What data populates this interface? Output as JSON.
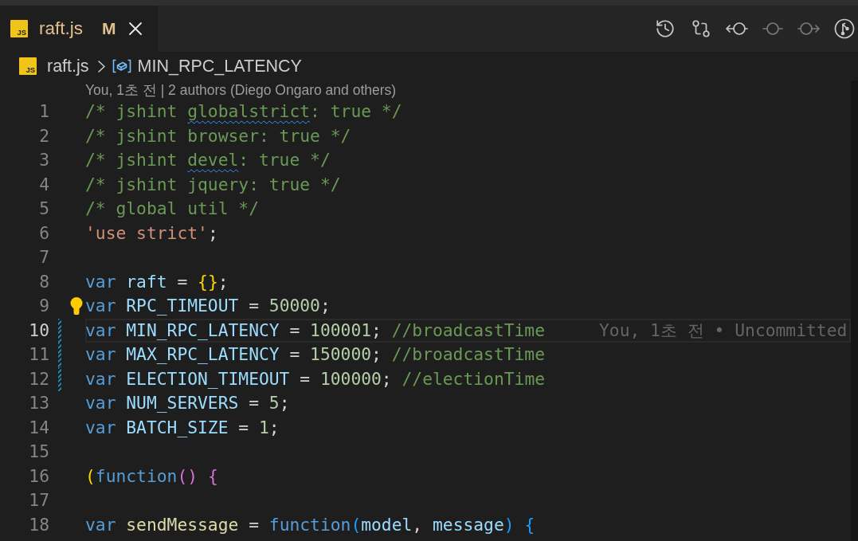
{
  "tabs": [
    {
      "icon_label": "JS",
      "label": "raft.js",
      "status": "M",
      "selected": true,
      "modified": true
    }
  ],
  "toolbar": [
    {
      "kind": "history",
      "disabled": false
    },
    {
      "kind": "compare",
      "disabled": false
    },
    {
      "kind": "previous",
      "disabled": false
    },
    {
      "kind": "commit",
      "disabled": true
    },
    {
      "kind": "next",
      "disabled": true
    },
    {
      "kind": "inspect",
      "disabled": false
    }
  ],
  "breadcrumbs": [
    {
      "kind": "file",
      "icon_label": "JS",
      "label": "raft.js"
    },
    {
      "kind": "variable",
      "label": "MIN_RPC_LATENCY"
    }
  ],
  "code_lens": "You, 1초 전 | 2 authors (Diego Ongaro and others)",
  "lines": [
    {
      "number": "1",
      "current": false,
      "changed": false,
      "lightbulb": false,
      "tokens": [
        {
          "kind": "comment",
          "text": "/* jshint ",
          "squiggle": false
        },
        {
          "kind": "comment",
          "text": "globalstrict",
          "squiggle": true
        },
        {
          "kind": "comment",
          "text": ": true */",
          "squiggle": false
        }
      ]
    },
    {
      "number": "2",
      "current": false,
      "changed": false,
      "lightbulb": false,
      "tokens": [
        {
          "kind": "comment",
          "text": "/* jshint browser: true */"
        }
      ]
    },
    {
      "number": "3",
      "current": false,
      "changed": false,
      "lightbulb": false,
      "tokens": [
        {
          "kind": "comment",
          "text": "/* jshint ",
          "squiggle": false
        },
        {
          "kind": "comment",
          "text": "devel",
          "squiggle": true
        },
        {
          "kind": "comment",
          "text": ": true */",
          "squiggle": false
        }
      ]
    },
    {
      "number": "4",
      "current": false,
      "changed": false,
      "lightbulb": false,
      "tokens": [
        {
          "kind": "comment",
          "text": "/* jshint jquery: true */"
        }
      ]
    },
    {
      "number": "5",
      "current": false,
      "changed": false,
      "lightbulb": false,
      "tokens": [
        {
          "kind": "comment",
          "text": "/* global util */"
        }
      ]
    },
    {
      "number": "6",
      "current": false,
      "changed": false,
      "lightbulb": false,
      "tokens": [
        {
          "kind": "string",
          "text": "'use strict'"
        },
        {
          "kind": "punct",
          "text": ";"
        }
      ]
    },
    {
      "number": "7",
      "current": false,
      "changed": false,
      "lightbulb": false
    },
    {
      "number": "8",
      "current": false,
      "changed": false,
      "lightbulb": false,
      "tokens": [
        {
          "kind": "keyword",
          "text": "var "
        },
        {
          "kind": "variable",
          "text": "raft"
        },
        {
          "kind": "operator",
          "text": " = "
        },
        {
          "kind": "bracket",
          "text": "{}",
          "color": "#ffd700"
        },
        {
          "kind": "punct",
          "text": ";"
        }
      ]
    },
    {
      "number": "9",
      "current": false,
      "changed": false,
      "lightbulb": true,
      "tokens": [
        {
          "kind": "keyword",
          "text": "var "
        },
        {
          "kind": "variable",
          "text": "RPC_TIMEOUT"
        },
        {
          "kind": "operator",
          "text": " = "
        },
        {
          "kind": "number",
          "text": "50000"
        },
        {
          "kind": "punct",
          "text": ";"
        }
      ]
    },
    {
      "number": "10",
      "current": true,
      "changed": true,
      "lightbulb": false,
      "tokens": [
        {
          "kind": "keyword",
          "text": "var "
        },
        {
          "kind": "variable",
          "text": "MIN_RPC_LATENCY"
        },
        {
          "kind": "operator",
          "text": " = "
        },
        {
          "kind": "number",
          "text": "100001"
        },
        {
          "kind": "punct",
          "text": "; "
        },
        {
          "kind": "comment",
          "text": "//broadcastTime"
        }
      ],
      "blame": "You, 1초 전 • Uncommitted"
    },
    {
      "number": "11",
      "current": false,
      "changed": true,
      "lightbulb": false,
      "tokens": [
        {
          "kind": "keyword",
          "text": "var "
        },
        {
          "kind": "variable",
          "text": "MAX_RPC_LATENCY"
        },
        {
          "kind": "operator",
          "text": " = "
        },
        {
          "kind": "number",
          "text": "150000"
        },
        {
          "kind": "punct",
          "text": "; "
        },
        {
          "kind": "comment",
          "text": "//broadcastTime"
        }
      ]
    },
    {
      "number": "12",
      "current": false,
      "changed": true,
      "lightbulb": false,
      "tokens": [
        {
          "kind": "keyword",
          "text": "var "
        },
        {
          "kind": "variable",
          "text": "ELECTION_TIMEOUT"
        },
        {
          "kind": "operator",
          "text": " = "
        },
        {
          "kind": "number",
          "text": "100000"
        },
        {
          "kind": "punct",
          "text": "; "
        },
        {
          "kind": "comment",
          "text": "//electionTime"
        }
      ]
    },
    {
      "number": "13",
      "current": false,
      "changed": false,
      "lightbulb": false,
      "tokens": [
        {
          "kind": "keyword",
          "text": "var "
        },
        {
          "kind": "variable",
          "text": "NUM_SERVERS"
        },
        {
          "kind": "operator",
          "text": " = "
        },
        {
          "kind": "number",
          "text": "5"
        },
        {
          "kind": "punct",
          "text": ";"
        }
      ]
    },
    {
      "number": "14",
      "current": false,
      "changed": false,
      "lightbulb": false,
      "tokens": [
        {
          "kind": "keyword",
          "text": "var "
        },
        {
          "kind": "variable",
          "text": "BATCH_SIZE"
        },
        {
          "kind": "operator",
          "text": " = "
        },
        {
          "kind": "number",
          "text": "1"
        },
        {
          "kind": "punct",
          "text": ";"
        }
      ]
    },
    {
      "number": "15",
      "current": false,
      "changed": false,
      "lightbulb": false
    },
    {
      "number": "16",
      "current": false,
      "changed": false,
      "lightbulb": false,
      "tokens": [
        {
          "kind": "bracket",
          "text": "(",
          "color": "#ffd700"
        },
        {
          "kind": "keyword",
          "text": "function"
        },
        {
          "kind": "bracket",
          "text": "()",
          "color": "#da70d6"
        },
        {
          "kind": "bracket",
          "text": " {",
          "color": "#da70d6"
        }
      ]
    },
    {
      "number": "17",
      "current": false,
      "changed": false,
      "lightbulb": false
    },
    {
      "number": "18",
      "current": false,
      "changed": false,
      "lightbulb": false,
      "tokens": [
        {
          "kind": "keyword",
          "text": "var "
        },
        {
          "kind": "function",
          "text": "sendMessage"
        },
        {
          "kind": "operator",
          "text": " = "
        },
        {
          "kind": "keyword",
          "text": "function"
        },
        {
          "kind": "bracket",
          "text": "(",
          "color": "#179fff"
        },
        {
          "kind": "param",
          "text": "model"
        },
        {
          "kind": "punct",
          "text": ", "
        },
        {
          "kind": "param",
          "text": "message"
        },
        {
          "kind": "bracket",
          "text": ")",
          "color": "#179fff"
        },
        {
          "kind": "bracket",
          "text": " {",
          "color": "#179fff"
        }
      ]
    }
  ]
}
